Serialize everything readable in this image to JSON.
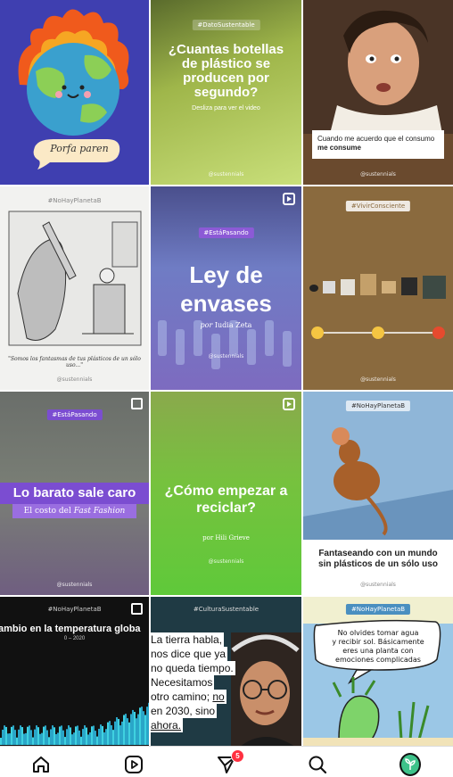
{
  "tiles": {
    "t1": {
      "text": "Porfa paren"
    },
    "t2": {
      "hashtag": "#DatoSustentable",
      "title": "¿Cuantas botellas de plástico se producen por segundo?",
      "subtitle": "Desliza para ver el video",
      "credit": "@sustennials"
    },
    "t3": {
      "caption_prefix": "Cuando me acuerdo que el consumo ",
      "caption_bold": "me consume",
      "credit": "@sustennials"
    },
    "t4": {
      "hashtag": "#NoHayPlanetaB",
      "caption": "\"Somos los fantasmas de tus plásticos de un sólo uso...\"",
      "credit": "@sustennials"
    },
    "t5": {
      "hashtag": "#EstáPasando",
      "title_line1": "Ley de",
      "title_line2": "envases",
      "byline_prefix": "por",
      "byline_name": "Iudia Zeta",
      "credit": "@sustennials"
    },
    "t6": {
      "hashtag": "#VivirConsciente",
      "credit": "@sustennials"
    },
    "t7": {
      "hashtag": "#EstáPasando",
      "title": "Lo barato sale caro",
      "subtitle_prefix": "El costo del ",
      "subtitle_italic": "Fast Fashion",
      "credit": "@sustennials"
    },
    "t8": {
      "title": "¿Cómo empezar a reciclar?",
      "byline": "por Hili Grieve",
      "credit": "@sustennials"
    },
    "t9": {
      "hashtag": "#NoHayPlanetaB",
      "caption": "Fantaseando con un mundo sin plásticos de un sólo uso",
      "credit": "@sustennials"
    },
    "t10": {
      "hashtag": "#NoHayPlanetaB",
      "title": "ambio en la temperatura globa",
      "subtitle": "0 – 2020"
    },
    "t11": {
      "hashtag": "#CulturaSustentable",
      "line1": "La tierra habla,",
      "line2": "nos dice que ya",
      "line3": "no queda tiempo.",
      "line4": "Necesitamos",
      "line5": "otro camino;",
      "line5_underlined": "no",
      "line6": "en 2030, sino",
      "line7": "ahora."
    },
    "t12": {
      "hashtag": "#NoHayPlanetaB",
      "bubble_line1": "No olvides tomar agua",
      "bubble_line2": "y recibir sol. Básicamente",
      "bubble_line3": "eres una planta con",
      "bubble_line4": "emociones complicadas"
    }
  },
  "nav": {
    "messages_badge": "5"
  },
  "colors": {
    "accent_purple": "#7b4dd1",
    "accent_green": "#5fc93a",
    "badge_red": "#ff3040"
  }
}
